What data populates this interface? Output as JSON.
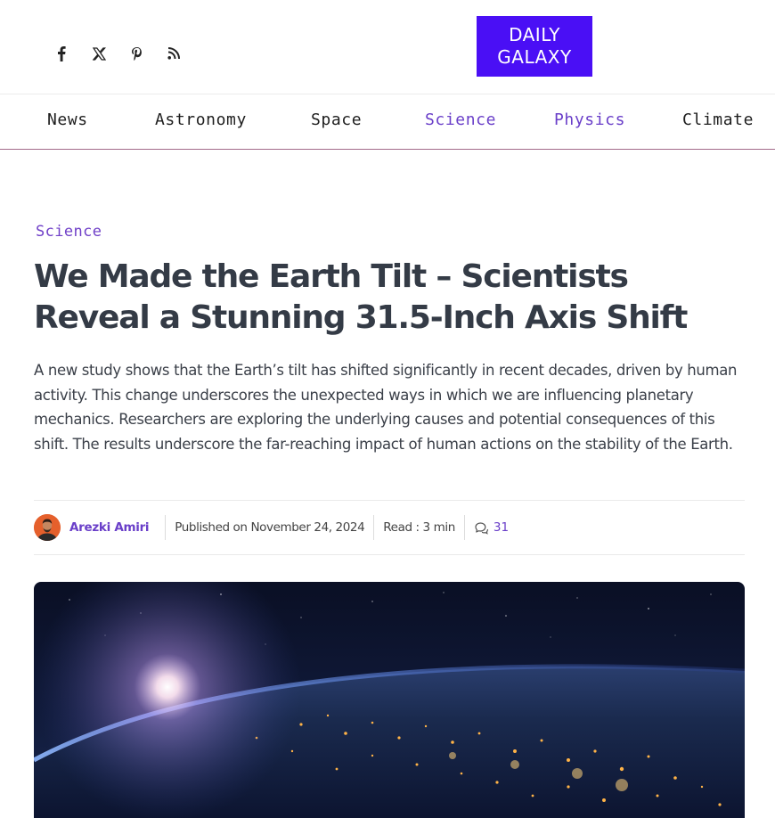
{
  "social": {
    "icons": [
      "facebook-icon",
      "x-twitter-icon",
      "pinterest-icon",
      "rss-icon"
    ]
  },
  "logo": {
    "line1": "DAILY",
    "line2": "GALAXY",
    "bg_color": "#4a0ff5"
  },
  "nav": {
    "items": [
      {
        "label": "News"
      },
      {
        "label": "Astronomy"
      },
      {
        "label": "Space"
      },
      {
        "label": "Science"
      },
      {
        "label": "Physics"
      },
      {
        "label": "Climate"
      }
    ],
    "accent_color": "#6a3fc9"
  },
  "article": {
    "category": "Science",
    "title": "We Made the Earth Tilt – Scientists Reveal a Stunning 31.5-Inch Axis Shift",
    "summary": "A new study shows that the Earth’s tilt has shifted significantly in recent decades, driven by human activity. This change underscores the unexpected ways in which we are influencing planetary mechanics. Researchers are exploring the underlying causes and potential consequences of this shift. The results underscore the far-reaching impact of human actions on the stability of the Earth.",
    "author": "Arezki Amiri",
    "published": "Published on November 24, 2024",
    "read_time": "Read : 3 min",
    "comments_count": "31",
    "hero_description_icon": "earth-night-image"
  }
}
